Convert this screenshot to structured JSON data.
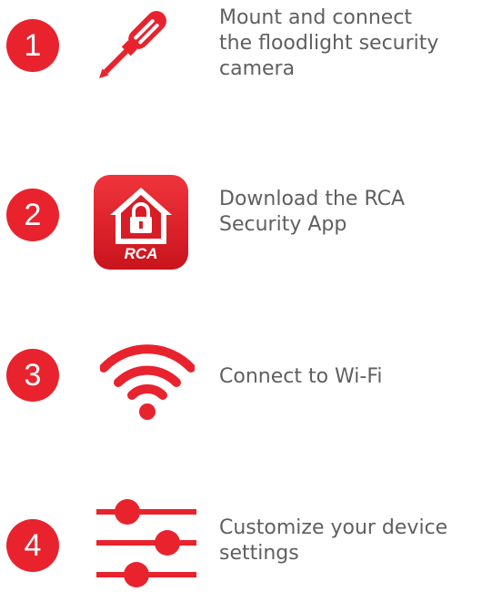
{
  "accent_color": "#e8232e",
  "text_color": "#5f5f5f",
  "steps": [
    {
      "number": "1",
      "icon": "screwdriver-icon",
      "lines": [
        "Mount and connect",
        "the floodlight security",
        "camera"
      ]
    },
    {
      "number": "2",
      "icon": "rca-security-app-icon",
      "app_icon_text": "RCA",
      "lines": [
        "Download the RCA",
        "Security App"
      ]
    },
    {
      "number": "3",
      "icon": "wifi-icon",
      "lines": [
        "Connect to Wi-Fi"
      ]
    },
    {
      "number": "4",
      "icon": "settings-sliders-icon",
      "lines": [
        "Customize your device",
        "settings"
      ]
    }
  ]
}
